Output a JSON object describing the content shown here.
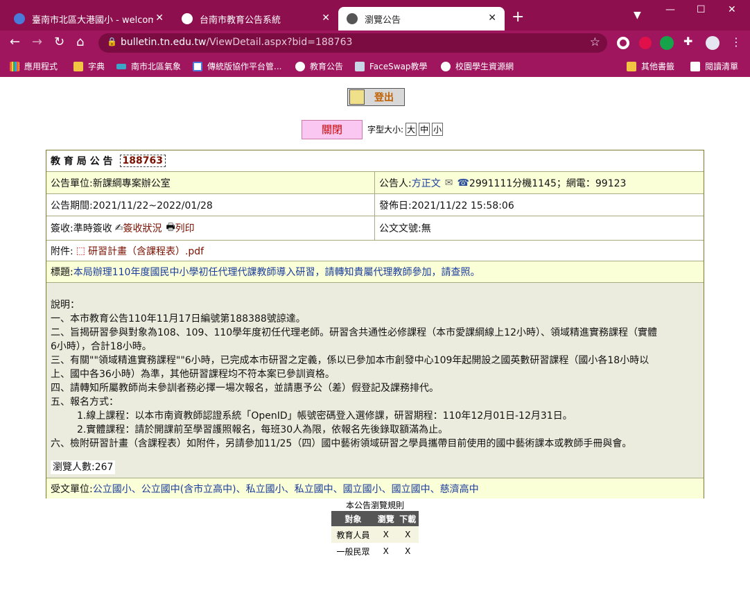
{
  "browser": {
    "tabs": [
      {
        "title": "臺南市北區大港國小 - welcome",
        "active": false,
        "icon_color": "#4a7bd8"
      },
      {
        "title": "台南市教育公告系統",
        "active": false,
        "icon_color": "#ffffff"
      },
      {
        "title": "瀏覽公告",
        "active": true,
        "icon_color": "#555555"
      }
    ],
    "url_host": "bulletin.tn.edu.tw",
    "url_path": "/ViewDetail.aspx?bid=188763",
    "bookmarks": [
      {
        "label": "應用程式",
        "icon": "apps-grid-icon"
      },
      {
        "label": "字典",
        "icon": "folder-icon"
      },
      {
        "label": "南市北區氣象",
        "icon": "weather-icon"
      },
      {
        "label": "傳統版協作平台管...",
        "icon": "page-icon"
      },
      {
        "label": "教育公告",
        "icon": "globe-icon"
      },
      {
        "label": "FaceSwap教學",
        "icon": "cube-icon"
      },
      {
        "label": "校園學生資源網",
        "icon": "globe-icon"
      }
    ],
    "other_bookmarks": "其他書籤",
    "reading_list": "閱讀清單"
  },
  "page": {
    "logout": "登出",
    "close": "關閉",
    "font_size_label": "字型大小:",
    "font_sizes": [
      "大",
      "中",
      "小"
    ],
    "header_label": "教 育 局 公 告",
    "bulletin_id": "188763",
    "unit_label": "公告單位:",
    "unit": "新課綱專案辦公室",
    "poster_label": "公告人:",
    "poster": "方正文",
    "phone": "2991111分機1145；網電：99123",
    "period": "公告期間:2021/11/22~2022/01/28",
    "publish": "發佈日:2021/11/22 15:58:06",
    "sign_label": "簽收:準時簽收",
    "sign_status": "簽收狀況",
    "print": "列印",
    "doc_no": "公文文號:無",
    "attach_label": "附件:",
    "attach_file": "研習計畫（含課程表）.pdf",
    "title_label": "標題:",
    "title": "本局辦理110年度國民中小學初任代理代課教師導入研習，請轉知貴屬代理教師參加，請查照。",
    "desc": [
      "說明：",
      "一、本市教育公告110年11月17日編號第188388號諒達。",
      "二、旨揭研習參與對象為108、109、110學年度初任代理老師。研習含共通性必修課程（本市愛課綱線上12小時）、領域精進實務課程（實體",
      "6小時），合計18小時。",
      "三、有關\"\"領域精進實務課程\"\"6小時，已完成本市研習之定義，係以已參加本市創發中心109年起開設之國英數研習課程（國小各18小時以",
      "上、國中各36小時）為準，其他研習課程均不符本案已參訓資格。",
      "四、請轉知所屬教師尚未參訓者務必擇一場次報名，並請惠予公（差）假登記及課務排代。",
      "五、報名方式："
    ],
    "desc_indent": [
      "1.線上課程：以本市南資教師認證系統「OpenID」帳號密碼登入選修課，研習期程：110年12月01日-12月31日。",
      "2.實體課程：請於開課前至學習護照報名，每班30人為限，依報名先後錄取額滿為止。"
    ],
    "desc_last": "六、檢附研習計畫（含課程表）如附件，另請參加11/25（四）國中藝術領域研習之學員攜帶目前使用的國中藝術課本或教師手冊與會。",
    "views": "瀏覽人數:267",
    "recipients_label": "受文單位:",
    "recipients": "公立國小、公立國中(含市立高中)、私立國小、私立國中、國立國小、國立國中、慈濟高中"
  },
  "rules": {
    "caption": "本公告瀏覽規則",
    "headers": [
      "對象",
      "瀏覽",
      "下載"
    ],
    "rows": [
      [
        "教育人員",
        "X",
        "X"
      ],
      [
        "一般民眾",
        "X",
        "X"
      ]
    ]
  }
}
